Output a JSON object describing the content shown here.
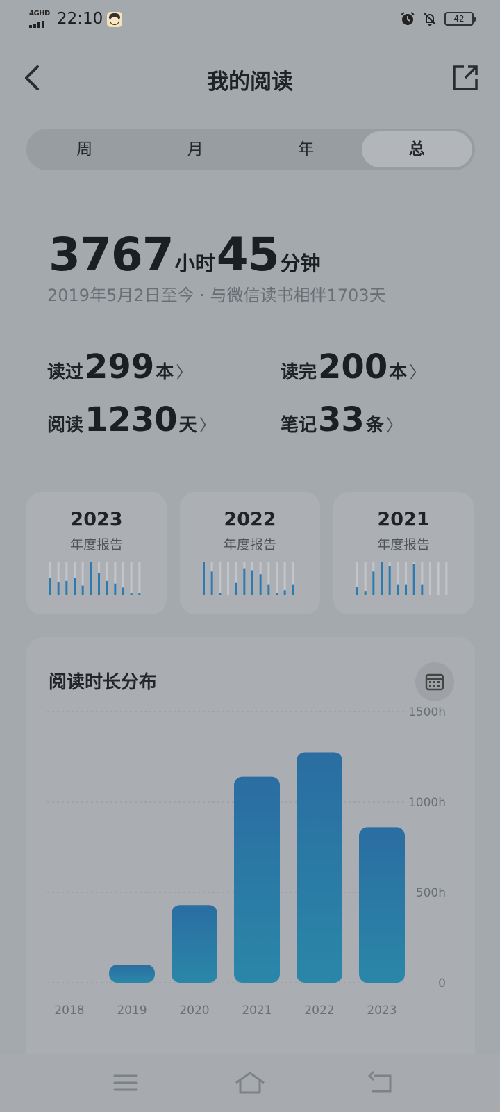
{
  "status_bar": {
    "network": "4GHD",
    "time": "22:10",
    "battery": "42"
  },
  "header": {
    "title": "我的阅读"
  },
  "tabs": [
    {
      "label": "周",
      "active": false
    },
    {
      "label": "月",
      "active": false
    },
    {
      "label": "年",
      "active": false
    },
    {
      "label": "总",
      "active": true
    }
  ],
  "summary": {
    "hours": "3767",
    "hours_unit": "小时",
    "minutes": "45",
    "minutes_unit": "分钟",
    "since": "2019年5月2日至今 · 与微信读书相伴1703天"
  },
  "stats": [
    {
      "label": "读过",
      "value": "299",
      "unit": "本"
    },
    {
      "label": "读完",
      "value": "200",
      "unit": "本"
    },
    {
      "label": "阅读",
      "value": "1230",
      "unit": "天"
    },
    {
      "label": "笔记",
      "value": "33",
      "unit": "条"
    }
  ],
  "annual_reports": [
    {
      "year": "2023",
      "label": "年度报告",
      "bars": [
        0.5,
        0.38,
        0.42,
        0.5,
        0.28,
        0.98,
        0.66,
        0.42,
        0.34,
        0.22,
        0.06,
        0.04
      ]
    },
    {
      "year": "2022",
      "label": "年度报告",
      "bars": [
        0.98,
        0.7,
        0.06,
        0,
        0.36,
        0.8,
        0.74,
        0.62,
        0.3,
        0.06,
        0.14,
        0.3
      ]
    },
    {
      "year": "2021",
      "label": "年度报告",
      "bars": [
        0.24,
        0.1,
        0.7,
        0.98,
        0.86,
        0.3,
        0.3,
        0.92,
        0.3,
        0,
        0,
        0
      ]
    }
  ],
  "distribution": {
    "title": "阅读时长分布"
  },
  "chart_data": {
    "type": "bar",
    "categories": [
      "2018",
      "2019",
      "2020",
      "2021",
      "2022",
      "2023"
    ],
    "values": [
      0,
      100,
      430,
      1140,
      1275,
      860
    ],
    "yticks": [
      "1500h",
      "1000h",
      "500h",
      "0"
    ],
    "ylim": [
      0,
      1500
    ],
    "grid": true,
    "colors": {
      "bar_top": "#2a6da2",
      "bar_bottom": "#2a87a8"
    }
  },
  "colors": {
    "accent": "#2d7ab0",
    "report_bar_bg": "#c2c6ca"
  }
}
